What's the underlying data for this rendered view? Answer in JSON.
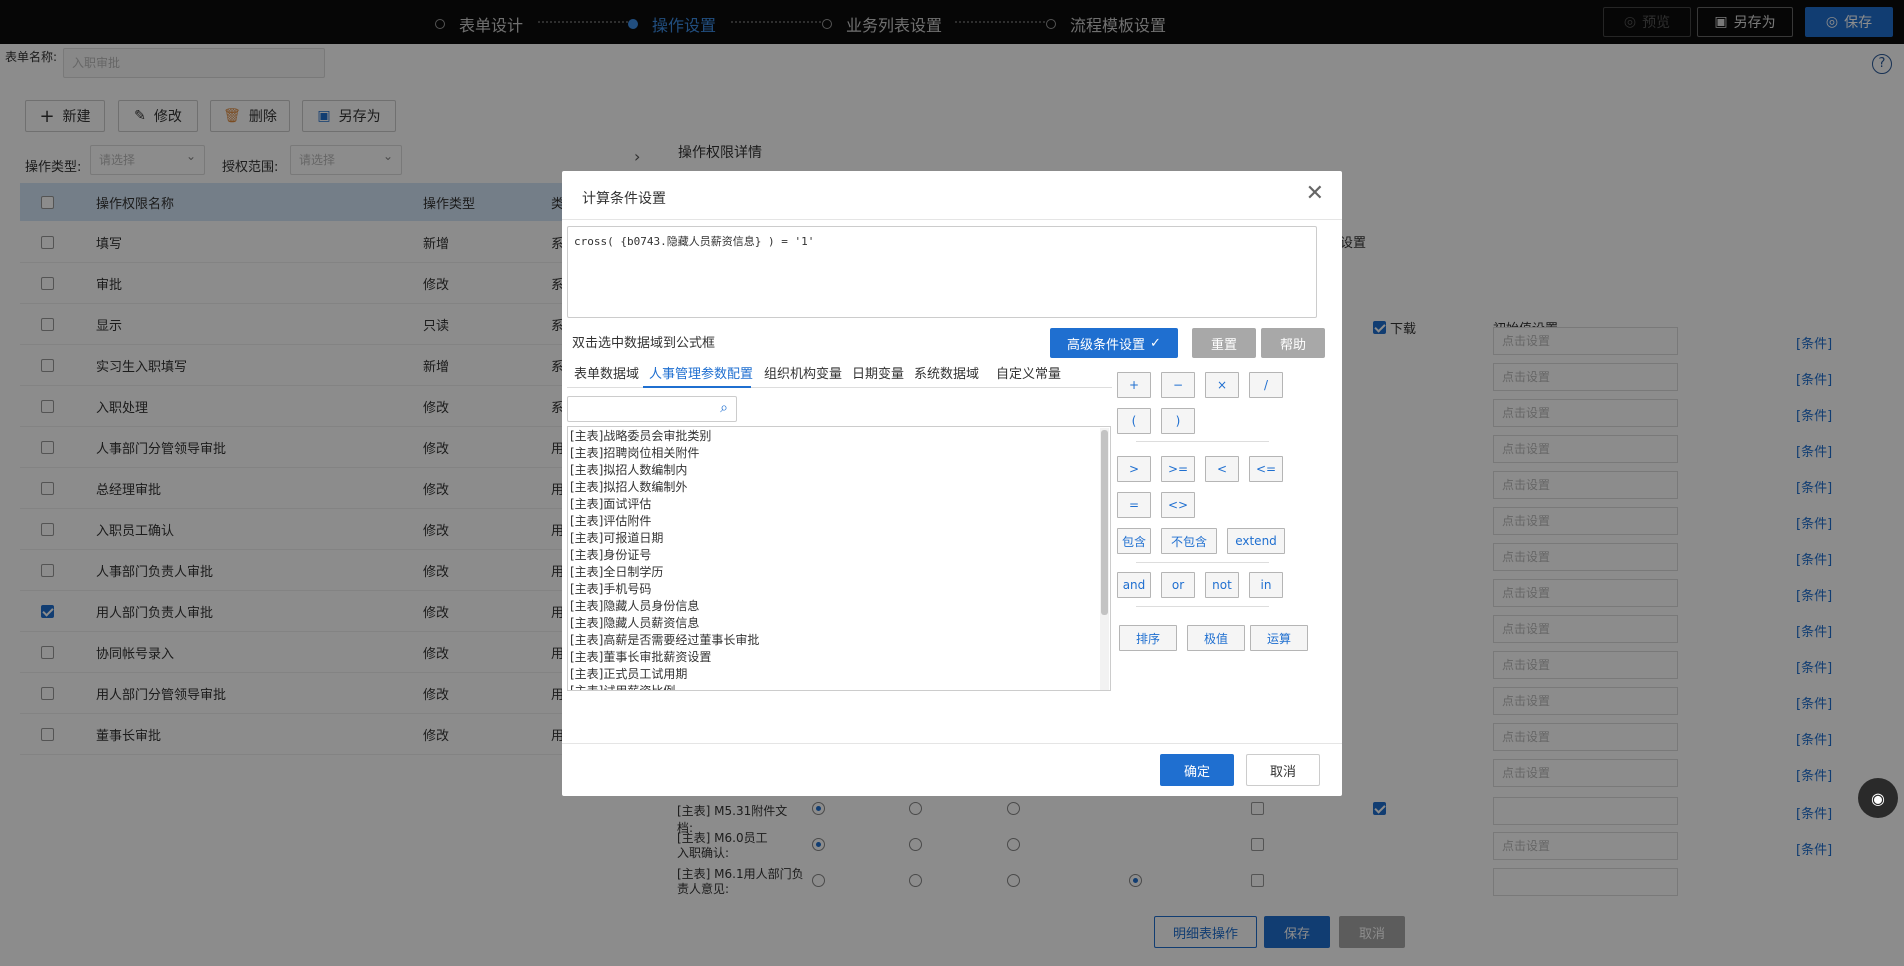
{
  "topbar": {
    "steps": [
      "表单设计",
      "操作设置",
      "业务列表设置",
      "流程模板设置"
    ],
    "preview_label": "预览",
    "save_as_label": "另存为",
    "save_label": "保存"
  },
  "form": {
    "name_label": "表单名称:",
    "name_value": "入职审批"
  },
  "actions": {
    "new": "新建",
    "edit": "修改",
    "delete": "删除",
    "save_as": "另存为"
  },
  "filters": {
    "type_label": "操作类型:",
    "type_placeholder": "请选择",
    "scope_label": "授权范围:",
    "scope_placeholder": "请选择"
  },
  "left_table": {
    "headers": [
      "操作权限名称",
      "操作类型",
      "类"
    ],
    "rows": [
      {
        "name": "填写",
        "type": "新增",
        "extra": "系"
      },
      {
        "name": "审批",
        "type": "修改",
        "extra": "系"
      },
      {
        "name": "显示",
        "type": "只读",
        "extra": "系"
      },
      {
        "name": "实习生入职填写",
        "type": "新增",
        "extra": "系"
      },
      {
        "name": "入职处理",
        "type": "修改",
        "extra": "系"
      },
      {
        "name": "人事部门分管领导审批",
        "type": "修改",
        "extra": "用"
      },
      {
        "name": "总经理审批",
        "type": "修改",
        "extra": "用"
      },
      {
        "name": "入职员工确认",
        "type": "修改",
        "extra": "用"
      },
      {
        "name": "人事部门负责人审批",
        "type": "修改",
        "extra": "用"
      },
      {
        "name": "用人部门负责人审批",
        "type": "修改",
        "extra": "用",
        "checked": true
      },
      {
        "name": "协同帐号录入",
        "type": "修改",
        "extra": "用"
      },
      {
        "name": "用人部门分管领导审批",
        "type": "修改",
        "extra": "用"
      },
      {
        "name": "董事长审批",
        "type": "修改",
        "extra": "用"
      }
    ]
  },
  "right_panel": {
    "title": "操作权限详情",
    "partial_label": "设置",
    "download_label": "下载",
    "init_label": "初始值设置",
    "click_set": "点击设置",
    "cond_link": "[条件]",
    "field_rows": [
      "[主表] M5.31附件文档:",
      "[主表] M6.0员工入职确认:",
      "[主表] M6.1用人部门负责人意见:"
    ],
    "bottom_buttons": [
      "明细表操作",
      "保存",
      "取消"
    ]
  },
  "modal": {
    "title": "计算条件设置",
    "formula": "cross( {b0743.隐藏人员薪资信息} )  =  '1'",
    "hint": "双击选中数据域到公式框",
    "advanced_label": "高级条件设置",
    "reset_label": "重置",
    "help_label": "帮助",
    "tabs": [
      "表单数据域",
      "人事管理参数配置",
      "组织机构变量",
      "日期变量",
      "系统数据域",
      "自定义常量"
    ],
    "active_tab": 1,
    "list_items": [
      "[主表]战略委员会审批类别",
      "[主表]招聘岗位相关附件",
      "[主表]拟招人数编制内",
      "[主表]拟招人数编制外",
      "[主表]面试评估",
      "[主表]评估附件",
      "[主表]可报道日期",
      "[主表]身份证号",
      "[主表]全日制学历",
      "[主表]手机号码",
      "[主表]隐藏人员身份信息",
      "[主表]隐藏人员薪资信息",
      "[主表]高薪是否需要经过董事长审批",
      "[主表]董事长审批薪资设置",
      "[主表]正式员工试用期",
      "[主表]试用薪资比例"
    ],
    "operators": {
      "arith": [
        "+",
        "−",
        "×",
        "/"
      ],
      "paren": [
        "(",
        ")"
      ],
      "compare": [
        ">",
        ">=",
        "<",
        "<="
      ],
      "equal": [
        "=",
        "<>"
      ],
      "contain": [
        "包含",
        "不包含",
        "extend"
      ],
      "logic": [
        "and",
        "or",
        "not",
        "in"
      ],
      "func": [
        "排序",
        "极值",
        "运算"
      ]
    },
    "confirm_label": "确定",
    "cancel_label": "取消"
  }
}
